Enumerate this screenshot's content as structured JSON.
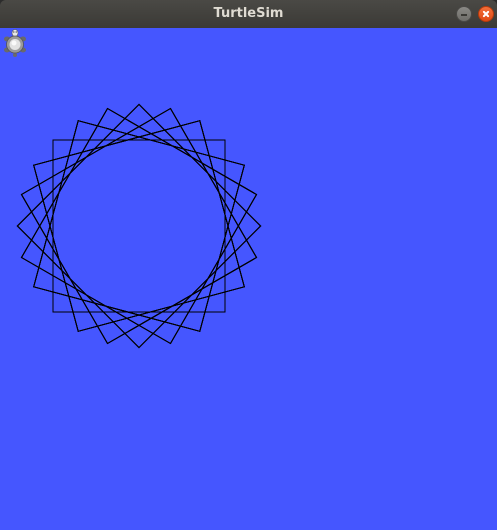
{
  "window": {
    "title": "TurtleSim",
    "buttons": [
      {
        "name": "minimize",
        "icon": "minimize-icon"
      },
      {
        "name": "close",
        "icon": "close-icon"
      }
    ]
  },
  "canvas": {
    "background_color": "#4556ff",
    "pen_color": "#000000"
  },
  "turtle": {
    "icon": "turtle-icon",
    "heading_deg": 90
  },
  "colors": {
    "titlebar": "#3f3e3a",
    "title_text": "#dfdbd2",
    "close_button": "#e95420"
  }
}
